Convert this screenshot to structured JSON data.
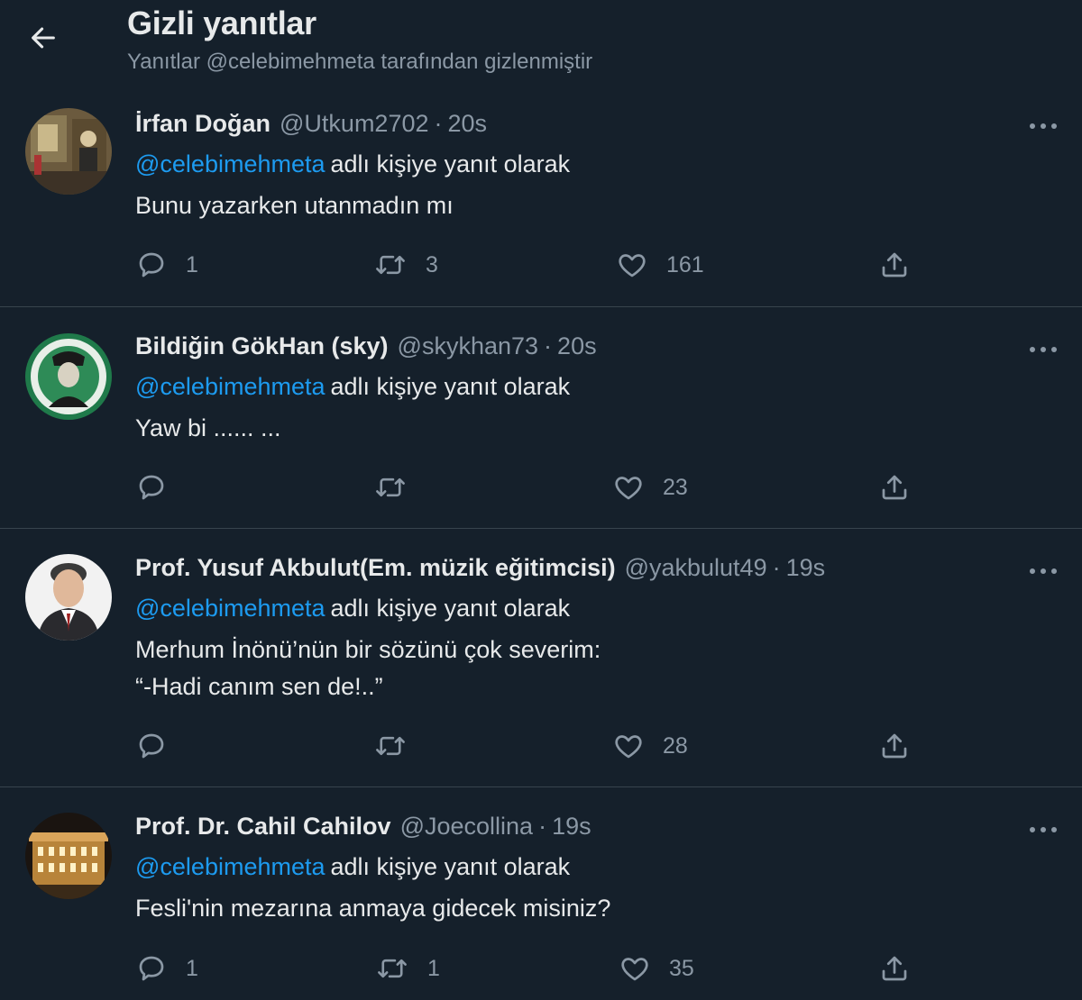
{
  "header": {
    "title": "Gizli yanıtlar",
    "subtitle": "Yanıtlar @celebimehmeta tarafından gizlenmiştir"
  },
  "tweets": [
    {
      "name": "İrfan Doğan",
      "handle": "@Utkum2702",
      "time": "20s",
      "mention": "@celebimehmeta",
      "reply_text": "adlı kişiye yanıt olarak",
      "body": [
        "Bunu yazarken utanmadın mı"
      ],
      "replies": "1",
      "retweets": "3",
      "likes": "161"
    },
    {
      "name": "Bildiğin GökHan (sky)",
      "handle": "@skykhan73",
      "time": "20s",
      "mention": "@celebimehmeta",
      "reply_text": "adlı kişiye yanıt olarak",
      "body": [
        "Yaw bi ...... ..."
      ],
      "replies": "",
      "retweets": "",
      "likes": "23"
    },
    {
      "name": "Prof. Yusuf Akbulut(Em. müzik eğitimcisi)",
      "handle": "@yakbulut49",
      "time": "19s",
      "mention": "@celebimehmeta",
      "reply_text": "adlı kişiye yanıt olarak",
      "body": [
        "Merhum İnönü’nün bir sözünü çok severim:",
        "“-Hadi canım sen de!..”"
      ],
      "replies": "",
      "retweets": "",
      "likes": "28"
    },
    {
      "name": "Prof. Dr. Cahil Cahilov",
      "handle": "@Joecollina",
      "time": "19s",
      "mention": "@celebimehmeta",
      "reply_text": "adlı kişiye yanıt olarak",
      "body": [
        "Fesli'nin mezarına anmaya gidecek misiniz?"
      ],
      "replies": "1",
      "retweets": "1",
      "likes": "35"
    }
  ],
  "dot_separator": "·",
  "colors": {
    "background": "#15202b",
    "divider": "#38444d",
    "text": "#e7e9ea",
    "muted": "#8b98a5",
    "accent": "#1d9bf0"
  },
  "icons": {
    "back": "arrow-left-icon",
    "more": "more-horizontal-icon",
    "reply": "reply-bubble-icon",
    "retweet": "retweet-icon",
    "like": "heart-icon",
    "share": "share-upload-icon"
  }
}
